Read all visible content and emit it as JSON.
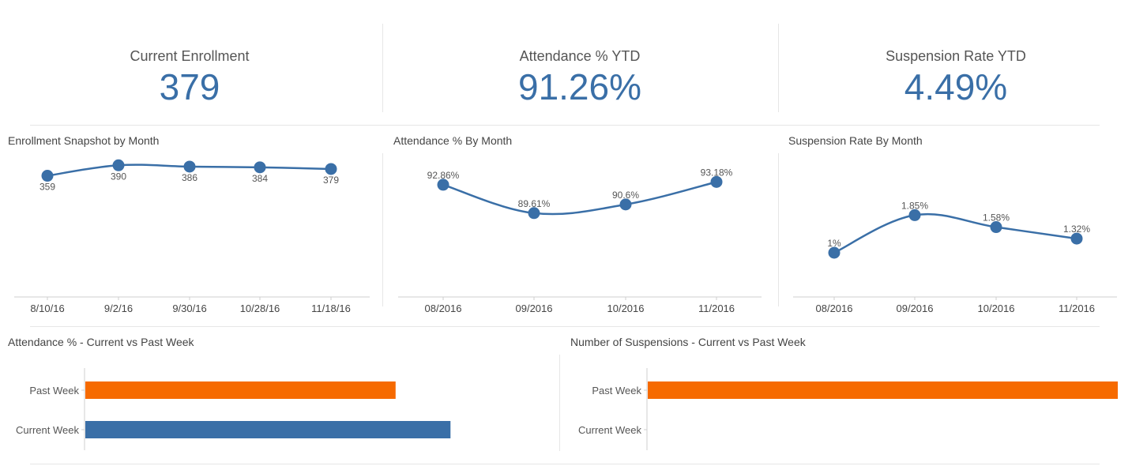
{
  "kpis": {
    "enrollment": {
      "label": "Current Enrollment",
      "value": "379"
    },
    "attendance": {
      "label": "Attendance % YTD",
      "value": "91.26%"
    },
    "suspension": {
      "label": "Suspension Rate YTD",
      "value": "4.49%"
    }
  },
  "colors": {
    "primary": "#3a6fa7",
    "accent": "#f66a00"
  },
  "chart_data": [
    {
      "id": "enrollment",
      "type": "line",
      "title": "Enrollment Snapshot by Month",
      "categories": [
        "8/10/16",
        "9/2/16",
        "9/30/16",
        "10/28/16",
        "11/18/16"
      ],
      "values": [
        359,
        390,
        386,
        384,
        379
      ],
      "labels": [
        "359",
        "390",
        "386",
        "384",
        "379"
      ],
      "ylim": [
        0,
        400
      ]
    },
    {
      "id": "attendance",
      "type": "line",
      "title": "Attendance % By Month",
      "categories": [
        "08/2016",
        "09/2016",
        "10/2016",
        "11/2016"
      ],
      "values": [
        92.86,
        89.61,
        90.6,
        93.18
      ],
      "labels": [
        "92.86%",
        "89.61%",
        "90.6%",
        "93.18%"
      ],
      "ylim": [
        80,
        100
      ]
    },
    {
      "id": "suspension",
      "type": "line",
      "title": "Suspension Rate By Month",
      "categories": [
        "08/2016",
        "09/2016",
        "10/2016",
        "11/2016"
      ],
      "values": [
        1,
        1.85,
        1.58,
        1.32
      ],
      "labels": [
        "1%",
        "1.85%",
        "1.58%",
        "1.32%"
      ],
      "ylim": [
        0,
        2.5
      ]
    },
    {
      "id": "attendance_week",
      "type": "bar",
      "title": "Attendance % - Current vs Past Week",
      "categories": [
        "Past Week",
        "Current Week"
      ],
      "values": [
        85,
        100
      ],
      "xlim": [
        0,
        128
      ]
    },
    {
      "id": "suspensions_week",
      "type": "bar",
      "title": "Number of Suspensions - Current vs Past Week",
      "categories": [
        "Past Week",
        "Current Week"
      ],
      "values": [
        1,
        0
      ],
      "xlim": [
        0,
        1
      ]
    }
  ]
}
